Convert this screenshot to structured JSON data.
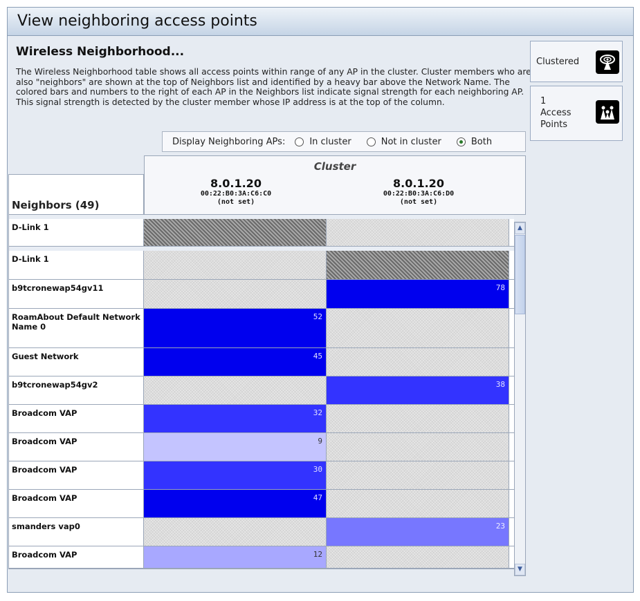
{
  "panel": {
    "title": "View neighboring access points",
    "subtitle": "Wireless Neighborhood...",
    "description": "The Wireless Neighborhood table shows all access points within range of any AP in the cluster. Cluster members who are also \"neighbors\" are shown at the top of Neighbors list and identified by a heavy bar above the Network Name. The colored bars and numbers to the right of each AP in the Neighbors list indicate signal strength for each neighboring AP. This signal strength is detected by the cluster member whose IP address is at the top of the column."
  },
  "side": {
    "clustered": {
      "label": "Clustered",
      "icon": "clustered-icon"
    },
    "access_points": {
      "count": "1",
      "line1": "Access",
      "line2": "Points",
      "icon": "access-points-icon"
    }
  },
  "filter": {
    "label": "Display Neighboring APs:",
    "options": [
      {
        "label": "In cluster",
        "selected": false
      },
      {
        "label": "Not in cluster",
        "selected": false
      },
      {
        "label": "Both",
        "selected": true
      }
    ]
  },
  "table": {
    "cluster_label": "Cluster",
    "neighbors_header": "Neighbors (49)",
    "columns": [
      {
        "ip": "8.0.1.20",
        "mac": "00:22:B0:3A:C6:C0",
        "name": "(not set)"
      },
      {
        "ip": "8.0.1.20",
        "mac": "00:22:B0:3A:C6:D0",
        "name": "(not set)"
      }
    ],
    "rows": [
      {
        "name": "D-Link 1",
        "cluster_member": true,
        "cells": [
          {
            "kind": "self",
            "value": ""
          },
          {
            "kind": "empty",
            "value": ""
          }
        ]
      },
      {
        "name": "D-Link 1",
        "cluster_member": true,
        "cells": [
          {
            "kind": "empty",
            "value": ""
          },
          {
            "kind": "self",
            "value": ""
          }
        ]
      },
      {
        "name": "b9tcronewap54gv11",
        "cluster_member": false,
        "cells": [
          {
            "kind": "empty",
            "value": ""
          },
          {
            "kind": "signal",
            "value": "78"
          }
        ]
      },
      {
        "name": "RoamAbout Default Network Name 0",
        "cluster_member": false,
        "cells": [
          {
            "kind": "signal",
            "value": "52"
          },
          {
            "kind": "empty",
            "value": ""
          }
        ]
      },
      {
        "name": "Guest Network",
        "cluster_member": false,
        "cells": [
          {
            "kind": "signal",
            "value": "45"
          },
          {
            "kind": "empty",
            "value": ""
          }
        ]
      },
      {
        "name": "b9tcronewap54gv2",
        "cluster_member": false,
        "cells": [
          {
            "kind": "empty",
            "value": ""
          },
          {
            "kind": "signal",
            "value": "38"
          }
        ]
      },
      {
        "name": "Broadcom VAP",
        "cluster_member": false,
        "cells": [
          {
            "kind": "signal",
            "value": "32"
          },
          {
            "kind": "empty",
            "value": ""
          }
        ]
      },
      {
        "name": "Broadcom VAP",
        "cluster_member": false,
        "cells": [
          {
            "kind": "signal",
            "value": "9"
          },
          {
            "kind": "empty",
            "value": ""
          }
        ]
      },
      {
        "name": "Broadcom VAP",
        "cluster_member": false,
        "cells": [
          {
            "kind": "signal",
            "value": "30"
          },
          {
            "kind": "empty",
            "value": ""
          }
        ]
      },
      {
        "name": "Broadcom VAP",
        "cluster_member": false,
        "cells": [
          {
            "kind": "signal",
            "value": "47"
          },
          {
            "kind": "empty",
            "value": ""
          }
        ]
      },
      {
        "name": "smanders vap0",
        "cluster_member": false,
        "cells": [
          {
            "kind": "empty",
            "value": ""
          },
          {
            "kind": "signal",
            "value": "23"
          }
        ]
      },
      {
        "name": "Broadcom VAP",
        "cluster_member": false,
        "cells": [
          {
            "kind": "signal",
            "value": "12"
          },
          {
            "kind": "empty",
            "value": ""
          }
        ]
      }
    ]
  },
  "colors": {
    "strong": "#0000ee",
    "medium": "#3333ff",
    "weak": "#7777ff",
    "very_weak": "#c4c4ff",
    "panel_bg": "#e6ebf2"
  }
}
